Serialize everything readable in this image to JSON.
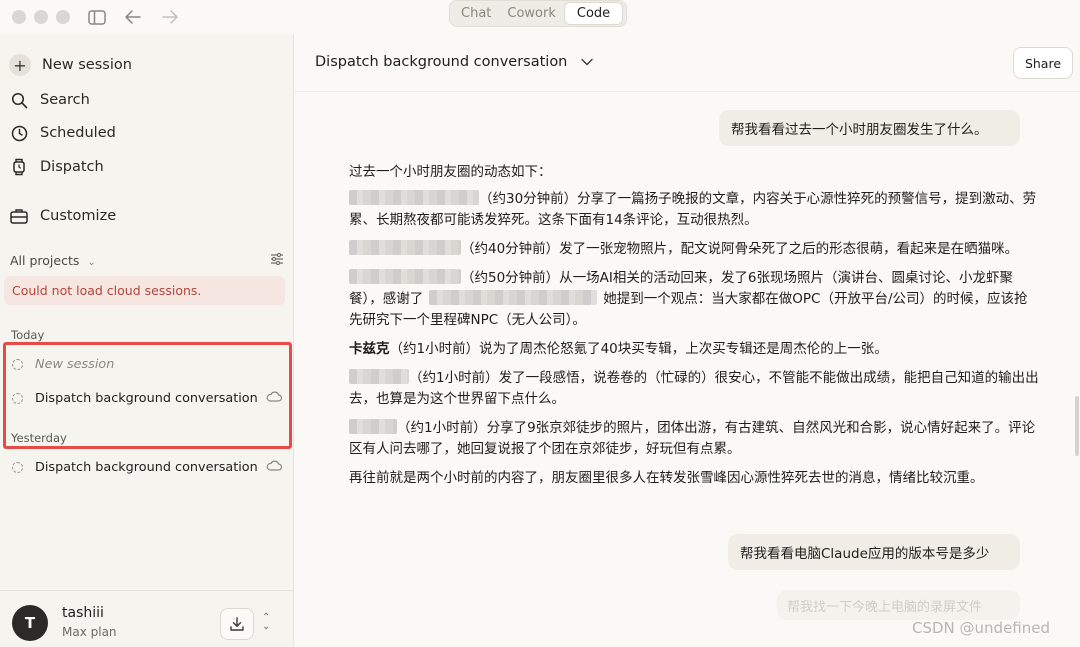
{
  "titlebar": {
    "tabs": [
      {
        "label": "Chat",
        "active": false
      },
      {
        "label": "Cowork",
        "active": false
      },
      {
        "label": "Code",
        "active": true
      }
    ]
  },
  "sidebar": {
    "nav": [
      {
        "label": "New session",
        "icon": "plus-icon"
      },
      {
        "label": "Search",
        "icon": "search-icon"
      },
      {
        "label": "Scheduled",
        "icon": "clock-icon"
      },
      {
        "label": "Dispatch",
        "icon": "watch-icon"
      },
      {
        "label": "Customize",
        "icon": "briefcase-icon"
      }
    ],
    "projects_label": "All projects",
    "error": "Could not load cloud sessions.",
    "groups": [
      {
        "label": "Today",
        "sessions": [
          "New session",
          "Dispatch background conversation"
        ]
      },
      {
        "label": "Yesterday",
        "sessions": [
          "Dispatch background conversation"
        ]
      }
    ],
    "user": {
      "initial": "T",
      "name": "tashiii",
      "plan": "Max plan"
    }
  },
  "main": {
    "title": "Dispatch background conversation",
    "share_label": "Share",
    "user_msg_1": "帮我看看过去一个小时朋友圈发生了什么。",
    "reply": {
      "intro": "过去一个小时朋友圈的动态如下：",
      "p1": "（约30分钟前）分享了一篇扬子晚报的文章，内容关于心源性猝死的预警信号，提到激动、劳累、长期熬夜都可能诱发猝死。这条下面有14条评论，互动很热烈。",
      "p2": "（约40分钟前）发了一张宠物照片，配文说阿骨朵死了之后的形态很萌，看起来是在晒猫咪。",
      "p3a": "（约50分钟前）从一场AI相关的活动回来，发了6张现场照片（演讲台、圆桌讨论、小龙虾聚餐），感谢了",
      "p3b": "她提到一个观点：当大家都在做OPC（开放平台/公司）的时候，应该抢先研究下一个里程碑NPC（无人公司）。",
      "p4_name": "卡兹克",
      "p4": "（约1小时前）说为了周杰伦怒氪了40块买专辑，上次买专辑还是周杰伦的上一张。",
      "p5": "（约1小时前）发了一段感悟，说卷卷的（忙碌的）很安心，不管能不能做出成绩，能把自己知道的输出出去，也算是为这个世界留下点什么。",
      "p6": "（约1小时前）分享了9张京郊徒步的照片，团体出游，有古建筑、自然风光和合影，说心情好起来了。评论区有人问去哪了，她回复说报了个团在京郊徒步，好玩但有点累。",
      "p7": "再往前就是两个小时前的内容了，朋友圈里很多人在转发张雪峰因心源性猝死去世的消息，情绪比较沉重。"
    },
    "user_msg_2": "帮我看看电脑Claude应用的版本号是多少",
    "user_msg_3_faded": "帮我找一下今晚上电脑的录屏文件"
  },
  "watermark": "CSDN @undefined"
}
